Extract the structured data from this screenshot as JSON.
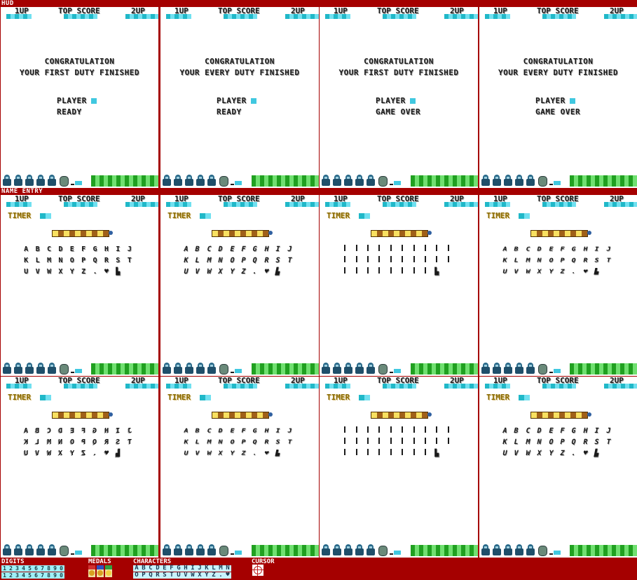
{
  "sections": {
    "hud": "HUD",
    "name_entry": "NAME ENTRY",
    "digits": "DIGITS",
    "medals": "MEDALS",
    "characters": "CHARACTERS",
    "cursor": "CURSOR"
  },
  "hud": {
    "p1": "1UP",
    "top": "TOP SCORE",
    "p2": "2UP",
    "timer": "TIMER"
  },
  "hud_panels": [
    {
      "line1": "CONGRATULATION",
      "line2": "YOUR FIRST DUTY FINISHED",
      "player": "PLAYER",
      "status": "READY"
    },
    {
      "line1": "CONGRATULATION",
      "line2": "YOUR EVERY DUTY FINISHED",
      "player": "PLAYER",
      "status": "READY"
    },
    {
      "line1": "CONGRATULATION",
      "line2": "YOUR FIRST DUTY FINISHED",
      "player": "PLAYER",
      "status": "GAME OVER"
    },
    {
      "line1": "CONGRATULATION",
      "line2": "YOUR EVERY DUTY FINISHED",
      "player": "PLAYER",
      "status": "GAME OVER"
    }
  ],
  "name_grids": {
    "normal": [
      [
        "A",
        "B",
        "C",
        "D",
        "E",
        "F",
        "G",
        "H",
        "I",
        "J"
      ],
      [
        "K",
        "L",
        "M",
        "N",
        "O",
        "P",
        "Q",
        "R",
        "S",
        "T"
      ],
      [
        "U",
        "V",
        "W",
        "X",
        "Y",
        "Z",
        ".",
        "♥",
        "▙",
        ""
      ]
    ],
    "mirrored": [
      [
        "A",
        "B",
        "C",
        "D",
        "E",
        "F",
        "G",
        "H",
        "I",
        "J"
      ],
      [
        "K",
        "L",
        "M",
        "N",
        "O",
        "P",
        "Q",
        "R",
        "S",
        "T"
      ],
      [
        "U",
        "V",
        "W",
        "X",
        "Y",
        "Z",
        ".",
        "♥",
        "▙",
        ""
      ]
    ]
  },
  "digits": {
    "row1": [
      "1",
      "2",
      "3",
      "4",
      "5",
      "6",
      "7",
      "8",
      "9",
      "0"
    ],
    "row2": [
      "1",
      "2",
      "3",
      "4",
      "5",
      "6",
      "7",
      "8",
      "9",
      "0"
    ]
  },
  "characters": {
    "row1": [
      "A",
      "B",
      "C",
      "D",
      "E",
      "F",
      "G",
      "H",
      "I",
      "J",
      "K",
      "L",
      "M",
      "N"
    ],
    "row2": [
      "O",
      "P",
      "Q",
      "R",
      "S",
      "T",
      "U",
      "V",
      "W",
      "X",
      "Y",
      "Z",
      ".",
      "♥"
    ]
  },
  "colors": {
    "background": "#a50000",
    "panel": "#ffffff",
    "cyan": "#20b8c8",
    "green": "#20a020",
    "timer_yellow": "#f8e060",
    "timer_brown": "#a06018"
  }
}
